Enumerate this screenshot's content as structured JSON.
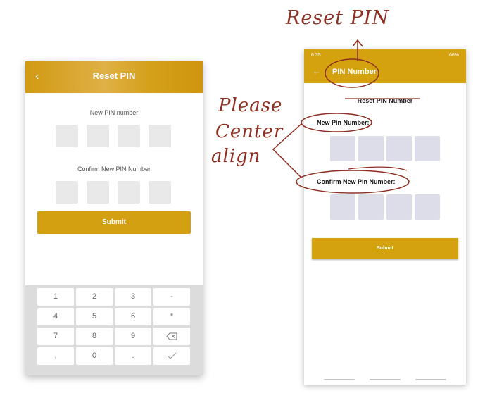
{
  "left_mockup": {
    "header_title": "Reset PIN",
    "back_icon": "chevron-left-icon",
    "new_pin_label": "New PIN number",
    "confirm_pin_label": "Confirm New PIN Number",
    "submit_label": "Submit",
    "keypad_keys": [
      "1",
      "2",
      "3",
      "-",
      "4",
      "5",
      "6",
      "*",
      "7",
      "8",
      "9",
      "",
      ",",
      "0",
      ".",
      ""
    ],
    "keypad_icons": {
      "backspace": "backspace-icon",
      "done": "check-icon"
    },
    "accent_color": "#d2a010"
  },
  "right_mockup": {
    "status_time": "6:35",
    "status_right": "66%",
    "header_title": "PIN Number",
    "back_icon": "arrow-left-icon",
    "heading": "Reset PIN Number",
    "new_pin_label": "New Pin Number:",
    "confirm_pin_label": "Confirm New Pin Number:",
    "submit_label": "Submit",
    "accent_color": "#d3a20e"
  },
  "annotations": {
    "title_note": "Reset PIN",
    "center_note_line1": "Please",
    "center_note_line2": "Center",
    "center_note_line3": "align",
    "ink_color": "#8e2f22"
  }
}
